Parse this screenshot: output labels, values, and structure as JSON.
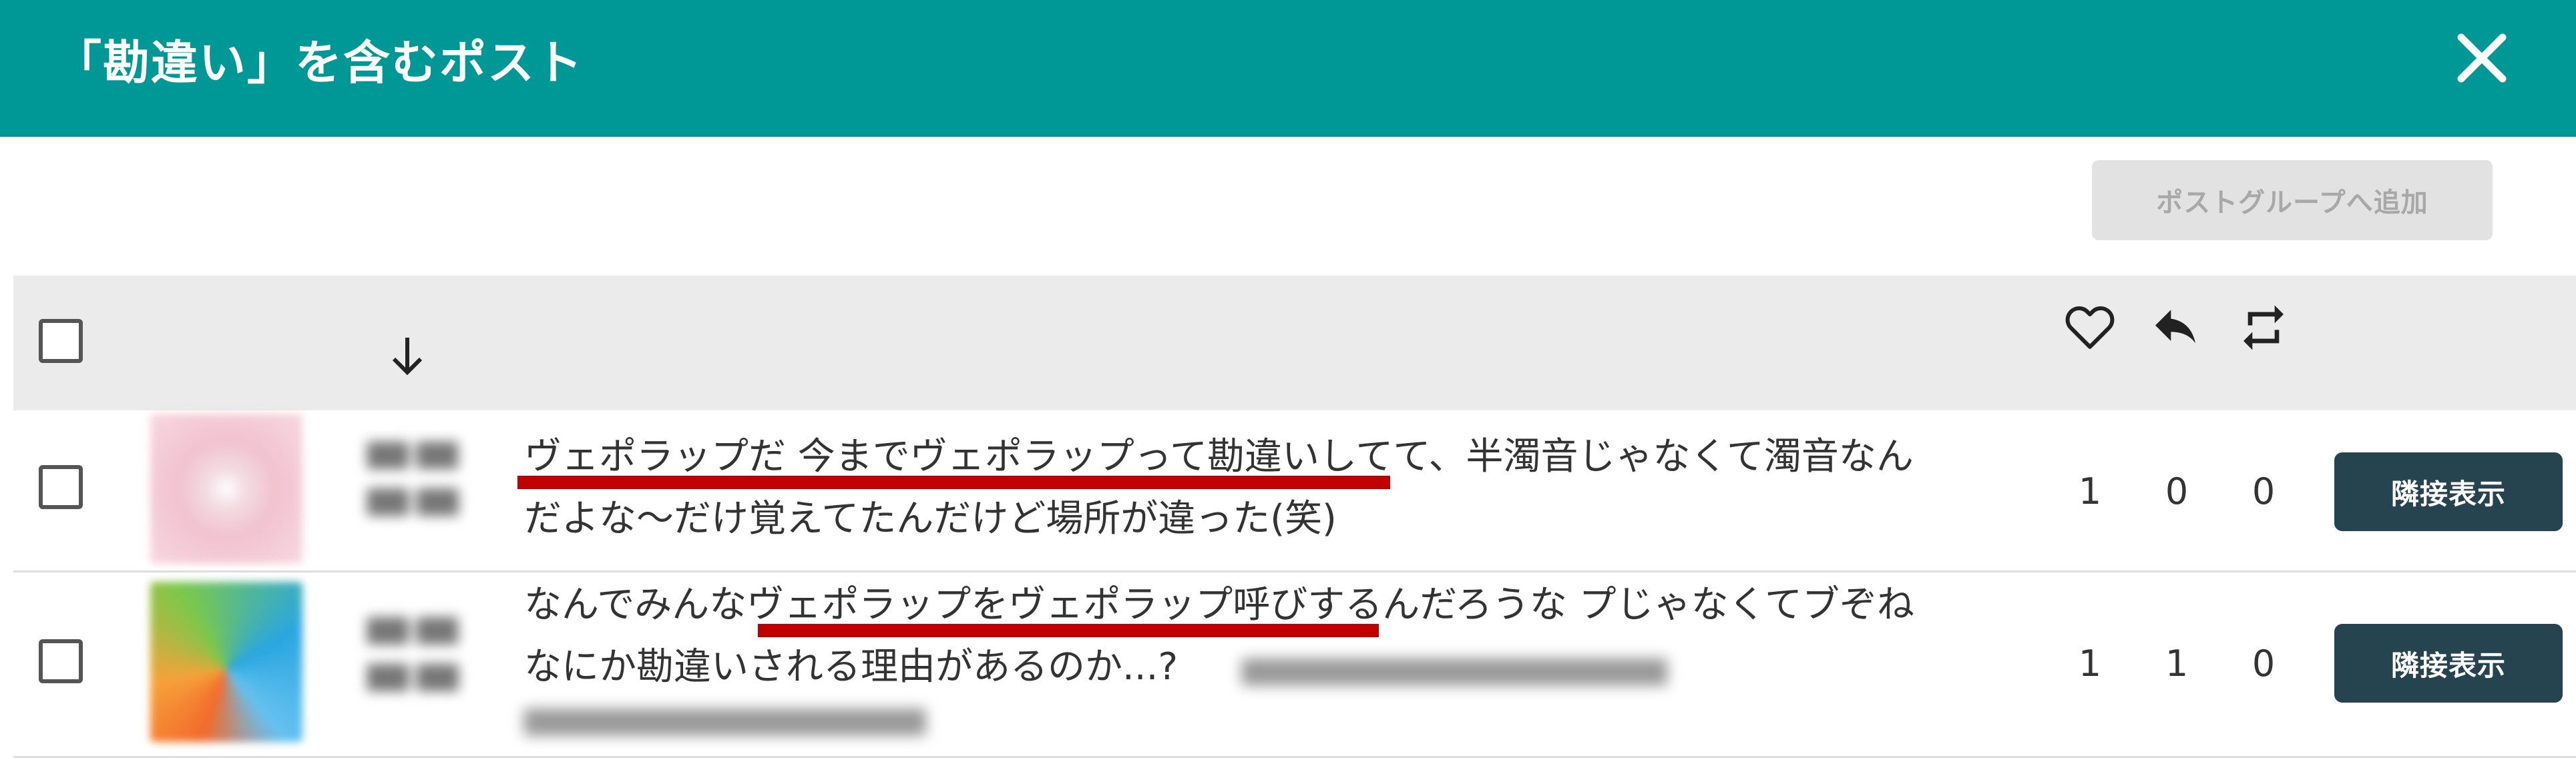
{
  "header": {
    "title": "「勘違い」を含むポスト",
    "close_icon": "close-icon"
  },
  "toolbar": {
    "add_to_group_label": "ポストグループへ追加"
  },
  "table": {
    "header_icons": [
      "select-all-checkbox",
      "sort-arrow-down-icon",
      "heart-icon",
      "reply-icon",
      "retweet-icon"
    ],
    "rows": [
      {
        "text_line1": "ヴェポラップだ 今までヴェポラップって勘違いしてて、半濁音じゃなくて濁音なん",
        "text_line2": "だよな〜だけ覚えてたんだけど場所が違った(笑)",
        "likes": "1",
        "replies": "0",
        "retweets": "0",
        "action_label": "隣接表示"
      },
      {
        "text_line1": "なんでみんなヴェポラップをヴェポラップ呼びするんだろうな プじゃなくてブぞね",
        "text_line2": "なにか勘違いされる理由があるのか...?",
        "likes": "1",
        "replies": "1",
        "retweets": "0",
        "action_label": "隣接表示"
      }
    ]
  },
  "colors": {
    "header_bg": "#009797",
    "highlight_underline": "#c00000",
    "action_button_bg": "#254450",
    "disabled_button_bg": "#e2e2e2"
  }
}
